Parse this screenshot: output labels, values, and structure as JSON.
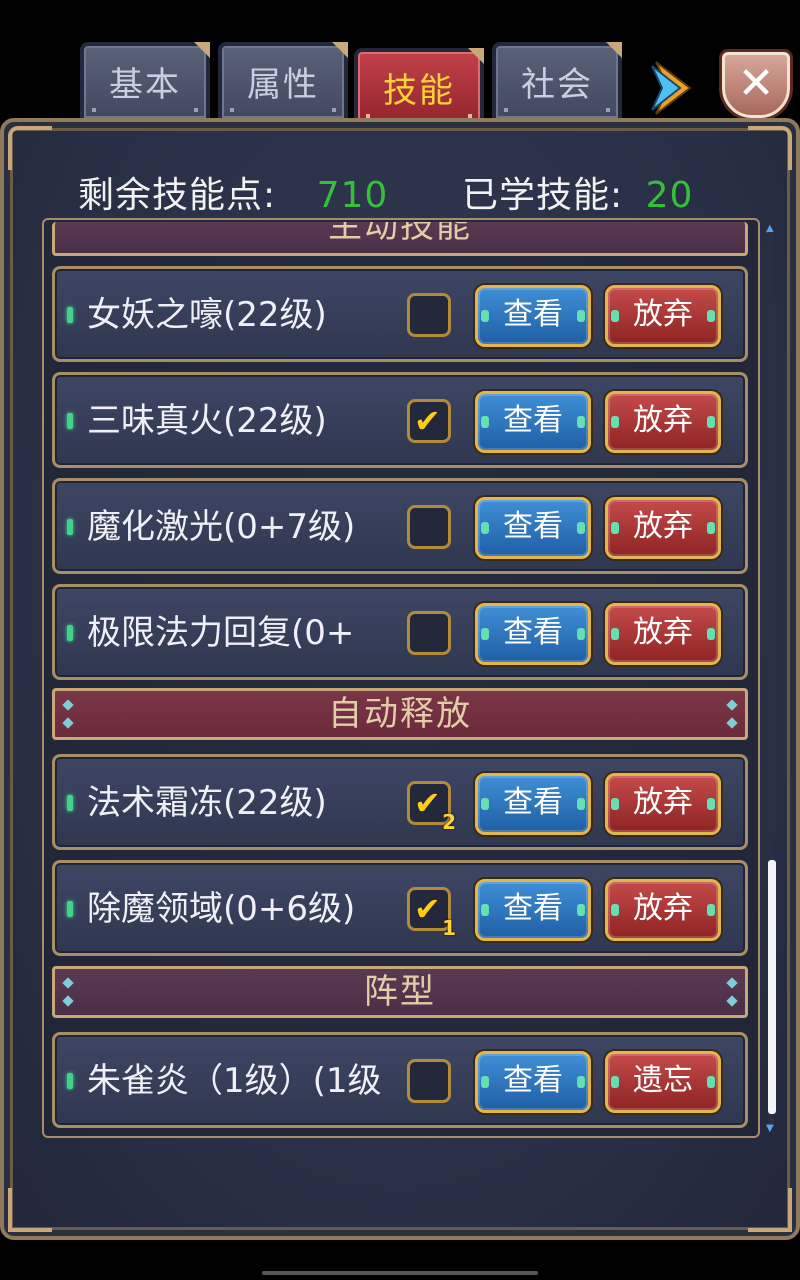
{
  "tabs": [
    {
      "label": "基本",
      "active": false
    },
    {
      "label": "属性",
      "active": false
    },
    {
      "label": "技能",
      "active": true
    },
    {
      "label": "社会",
      "active": false
    }
  ],
  "stats": {
    "remaining_label": "剩余技能点:",
    "remaining_value": "710",
    "learned_label": "已学技能:",
    "learned_value": "20"
  },
  "sections": {
    "active_skills": "主动技能",
    "auto_cast": "自动释放",
    "formation": "阵型"
  },
  "skills": [
    {
      "name": "女妖之嚎(22级)",
      "checked": false,
      "badge": "",
      "view_label": "查看",
      "action_label": "放弃"
    },
    {
      "name": "三味真火(22级)",
      "checked": true,
      "badge": "",
      "view_label": "查看",
      "action_label": "放弃"
    },
    {
      "name": "魔化激光(0+7级)",
      "checked": false,
      "badge": "",
      "view_label": "查看",
      "action_label": "放弃"
    },
    {
      "name": "极限法力回复(0+",
      "checked": false,
      "badge": "",
      "view_label": "查看",
      "action_label": "放弃"
    },
    {
      "name": "法术霜冻(22级)",
      "checked": true,
      "badge": "2",
      "view_label": "查看",
      "action_label": "放弃"
    },
    {
      "name": "除魔领域(0+6级)",
      "checked": true,
      "badge": "1",
      "view_label": "查看",
      "action_label": "放弃"
    },
    {
      "name": "朱雀炎（1级）(1级",
      "checked": false,
      "badge": "",
      "view_label": "查看",
      "action_label": "遗忘"
    }
  ],
  "icons": {
    "close": "close-icon",
    "next": "arrow-right-icon",
    "check": "checkmark-icon"
  },
  "colors": {
    "accent_gold": "#ffd43a",
    "stat_green": "#35c03a",
    "view_blue": "#2f78c4",
    "drop_red": "#a83434"
  },
  "scroll": {
    "position_fraction": 0.9
  }
}
